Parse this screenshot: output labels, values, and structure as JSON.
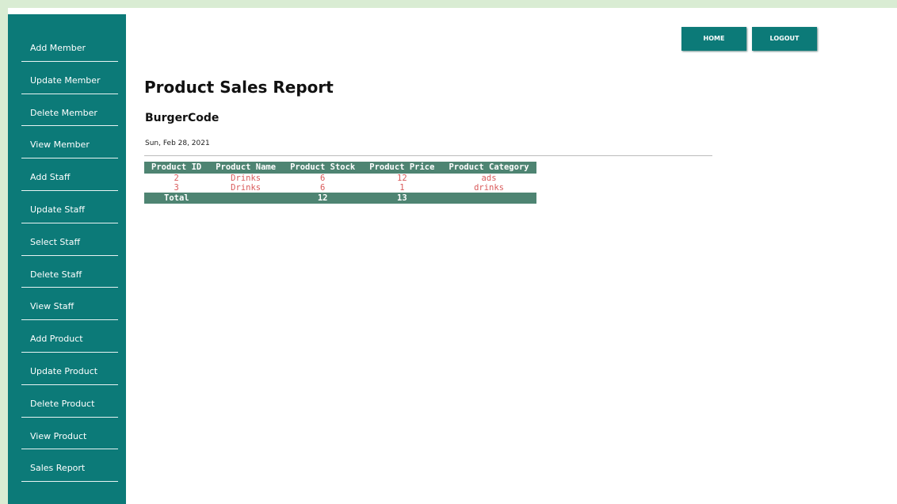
{
  "sidebar": {
    "items": [
      {
        "label": "Add Member"
      },
      {
        "label": "Update Member"
      },
      {
        "label": "Delete Member"
      },
      {
        "label": "View Member"
      },
      {
        "label": "Add Staff"
      },
      {
        "label": "Update Staff"
      },
      {
        "label": "Select Staff"
      },
      {
        "label": "Delete Staff"
      },
      {
        "label": "View Staff"
      },
      {
        "label": "Add Product"
      },
      {
        "label": "Update Product"
      },
      {
        "label": "Delete Product"
      },
      {
        "label": "View Product"
      },
      {
        "label": "Sales Report"
      }
    ]
  },
  "nav": {
    "home_label": "HOME",
    "logout_label": "LOGOUT"
  },
  "main": {
    "title": "Product Sales Report",
    "subtitle": "BurgerCode",
    "date": "Sun, Feb 28, 2021"
  },
  "table": {
    "headers": [
      "Product ID",
      "Product Name",
      "Product Stock",
      "Product Price",
      "Product Category"
    ],
    "rows": [
      [
        "2",
        "Drinks",
        "6",
        "12",
        "ads"
      ],
      [
        "3",
        "Drinks",
        "6",
        "1",
        "drinks"
      ]
    ],
    "total": {
      "label": "Total",
      "stock": "12",
      "price": "13"
    }
  },
  "colors": {
    "sidebar": "#0c7a78",
    "table_header": "#4e8472",
    "row_text": "#d95a5a",
    "frame_border": "#d9ecd3"
  }
}
